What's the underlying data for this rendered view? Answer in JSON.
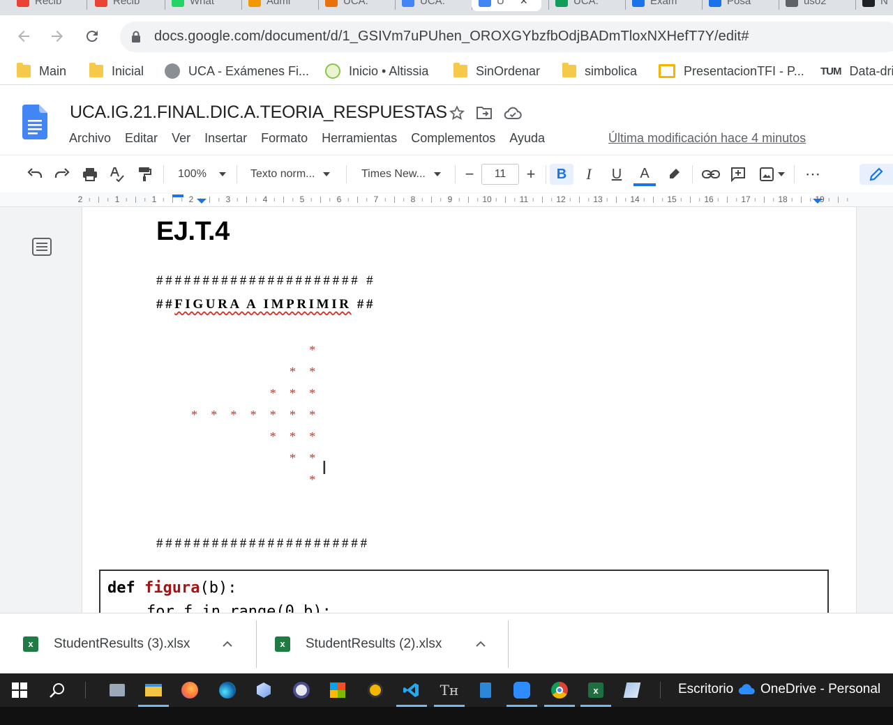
{
  "browser": {
    "tabs": [
      {
        "label": "Recib",
        "color": "#ea4335"
      },
      {
        "label": "Recib",
        "color": "#ea4335"
      },
      {
        "label": "What",
        "color": "#25d366"
      },
      {
        "label": "Admi",
        "color": "#f29900"
      },
      {
        "label": "UCA.",
        "color": "#e8710a"
      },
      {
        "label": "UCA.",
        "color": "#4285f4"
      },
      {
        "label": "U",
        "color": "#4285f4"
      },
      {
        "label": "UCA.",
        "color": "#0f9d58"
      },
      {
        "label": "Exam",
        "color": "#1a73e8"
      },
      {
        "label": "Posa",
        "color": "#1a73e8"
      },
      {
        "label": "uso2",
        "color": "#5f6368"
      },
      {
        "label": "N",
        "color": "#202124"
      }
    ],
    "url": "docs.google.com/document/d/1_GSIVm7uPUhen_OROXGYbzfbOdjBADmTloxNXHefT7Y/edit#",
    "bookmarks": [
      {
        "label": "Main",
        "icon": "folder-icon"
      },
      {
        "label": "Inicial",
        "icon": "folder-icon"
      },
      {
        "label": "UCA - Exámenes Fi...",
        "icon": "globe-icon"
      },
      {
        "label": "Inicio • Altissia",
        "icon": "altissia-icon"
      },
      {
        "label": "SinOrdenar",
        "icon": "folder-icon"
      },
      {
        "label": "simbolica",
        "icon": "folder-icon"
      },
      {
        "label": "PresentacionTFI - P...",
        "icon": "slides-icon"
      },
      {
        "label": "Data-dri",
        "icon": "tum-icon"
      }
    ],
    "tum_logo": "TUM"
  },
  "docs": {
    "title": "UCA.IG.21.FINAL.DIC.A.TEORIA_RESPUESTAS",
    "menu": [
      "Archivo",
      "Editar",
      "Ver",
      "Insertar",
      "Formato",
      "Herramientas",
      "Complementos",
      "Ayuda"
    ],
    "last_edit": "Última modificación hace 4 minutos",
    "toolbar": {
      "zoom": "100%",
      "style": "Texto norm...",
      "font": "Times New...",
      "font_size": "11",
      "bold": "B",
      "italic": "I",
      "underline": "U",
      "text_color": "A",
      "more": "⋯"
    },
    "ruler_labels": [
      "2",
      "1",
      "1",
      "2",
      "3",
      "4",
      "5",
      "6",
      "7",
      "8",
      "9",
      "10",
      "11",
      "12",
      "13",
      "14",
      "15",
      "16",
      "17",
      "18",
      "19"
    ]
  },
  "document": {
    "heading": "EJ.T.4",
    "hash_line_1": "###################### #",
    "caption_prefix": "##",
    "caption": "FIGURA A IMPRIMIR",
    "caption_suffix": " ##",
    "figure_rows": [
      "            *",
      "          * *",
      "        * * *",
      "* * * * * * *",
      "        * * *",
      "          * *",
      "            *"
    ],
    "hash_line_2": "#######################",
    "code_line_1_kw": "def",
    "code_line_1_fn": "figura",
    "code_line_1_rest": "(b):",
    "code_line_2": "for f in range(0,b):"
  },
  "downloads": [
    {
      "name": "StudentResults (3).xlsx"
    },
    {
      "name": "StudentResults (2).xlsx"
    }
  ],
  "taskbar": {
    "desktop_label": "Escritorio",
    "onedrive_label": "OneDrive - Personal"
  },
  "colors": {
    "docs_blue": "#4285f4",
    "figure_star": "#c0392b",
    "bold_active_bg": "#e8f0fe"
  }
}
